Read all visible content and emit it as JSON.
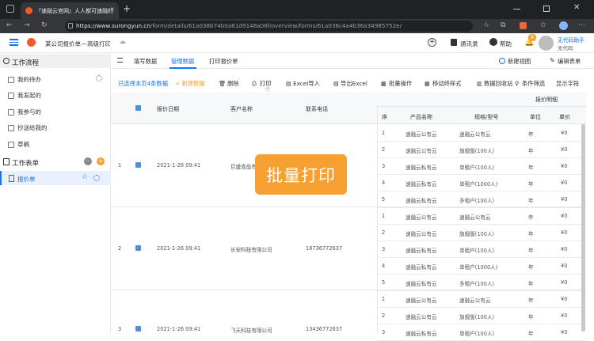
{
  "browser": {
    "tab_title": "『速融云官网』人人都可速融的",
    "tab_close": "✕",
    "new_tab": "+",
    "url_host": "https://www.surongyun.cn",
    "url_path": "/form/details/61a038b74b0a61d9148a06f/overview/forms/61a038c4a4b36a34985752e/"
  },
  "header": {
    "title": "某公司报价单---高级打印",
    "contacts_label": "通讯录",
    "help_label": "帮助",
    "notification_badge": "8",
    "user_company": "无代码助手",
    "user_name": "无代码"
  },
  "sidebar": {
    "section1_title": "工作流程",
    "items": [
      {
        "label": "我的待办"
      },
      {
        "label": "我发起的"
      },
      {
        "label": "我参与的"
      },
      {
        "label": "抄送给我的"
      },
      {
        "label": "草稿"
      }
    ],
    "section2_title": "工作表单",
    "form_item": "报价单"
  },
  "subtabs": {
    "fill": "填写数据",
    "manage": "管理数据",
    "print": "打印报价单",
    "new_view": "新建视图",
    "edit_form": "编辑表单"
  },
  "toolbar": {
    "selected_text": "已选择本页4条数据",
    "add": "+ 新建数据",
    "delete": "删除",
    "print": "打印",
    "excel_import": "Excel导入",
    "excel_export": "导出Excel",
    "batch": "批量操作",
    "move_style": "移动终样式",
    "recycle": "数据回收站",
    "filter": "条件筛选",
    "fields": "显示字段"
  },
  "table": {
    "col_date": "报价日期",
    "col_customer": "客户名称",
    "col_phone": "联系电话",
    "col_detail": "报价明细",
    "sub_seq": "序",
    "sub_product": "产品名称",
    "sub_spec": "规格/型号",
    "sub_unit": "单位",
    "sub_price": "单价",
    "records": [
      {
        "index": "1",
        "date": "2021-1-26 09:41",
        "customer": "巨盛食品有限公司",
        "phone": ""
      },
      {
        "index": "2",
        "date": "2021-1-26 09:41",
        "customer": "长安科技有限公司",
        "phone": "18736772637"
      },
      {
        "index": "3",
        "date": "2021-1-26 09:41",
        "customer": "飞天科技有限公司",
        "phone": "13436772637"
      }
    ],
    "details": [
      {
        "seq": "1",
        "product": "速融云公有云",
        "spec": "速融云公有云",
        "unit": "年",
        "price": "¥0"
      },
      {
        "seq": "2",
        "product": "速融云公有云",
        "spec": "旗舰版(100人)",
        "unit": "年",
        "price": "¥0"
      },
      {
        "seq": "3",
        "product": "速融云私有云",
        "spec": "单租户(100人)",
        "unit": "年",
        "price": "¥0"
      },
      {
        "seq": "4",
        "product": "速融云私有云",
        "spec": "单租户(1000人)",
        "unit": "年",
        "price": "¥0"
      },
      {
        "seq": "5",
        "product": "速融云私有云",
        "spec": "多租户(100人)",
        "unit": "年",
        "price": "¥0"
      },
      {
        "seq": "1",
        "product": "速融云公有云",
        "spec": "速融云公有云",
        "unit": "年",
        "price": "¥0"
      },
      {
        "seq": "2",
        "product": "速融云公有云",
        "spec": "旗舰版(100人)",
        "unit": "年",
        "price": "¥0"
      },
      {
        "seq": "3",
        "product": "速融云私有云",
        "spec": "单租户(100人)",
        "unit": "年",
        "price": "¥0"
      },
      {
        "seq": "4",
        "product": "速融云私有云",
        "spec": "单租户(1000人)",
        "unit": "年",
        "price": "¥0"
      },
      {
        "seq": "5",
        "product": "速融云私有云",
        "spec": "多租户(100人)",
        "unit": "年",
        "price": "¥0"
      },
      {
        "seq": "1",
        "product": "速融云公有云",
        "spec": "速融云公有云",
        "unit": "年",
        "price": "¥0"
      },
      {
        "seq": "2",
        "product": "速融云公有云",
        "spec": "旗舰版(100人)",
        "unit": "年",
        "price": "¥0"
      },
      {
        "seq": "3",
        "product": "速融云私有云",
        "spec": "单租户(100人)",
        "unit": "年",
        "price": "¥0"
      }
    ]
  },
  "overlay": {
    "text": "批量打印"
  },
  "colors": {
    "accent": "#1a73e8",
    "overlay_orange": "#f5a030",
    "logo_orange": "#f25a2c"
  }
}
